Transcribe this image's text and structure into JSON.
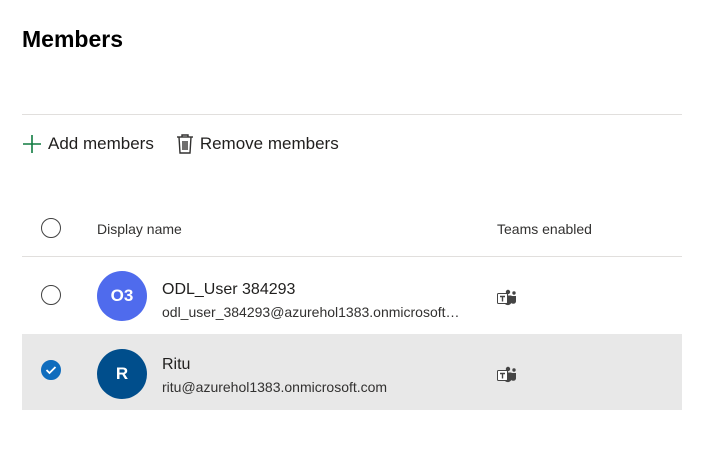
{
  "page": {
    "title": "Members"
  },
  "toolbar": {
    "add_label": "Add members",
    "add_icon": "plus-icon",
    "remove_label": "Remove members",
    "remove_icon": "trash-icon"
  },
  "table": {
    "columns": {
      "display_name": "Display name",
      "teams_enabled": "Teams enabled"
    },
    "rows": [
      {
        "initials": "O3",
        "avatar_color": "#4f6bed",
        "name": "ODL_User 384293",
        "email": "odl_user_384293@azurehol1383.onmicrosoft.com",
        "teams_icon": "teams-icon",
        "selected": false
      },
      {
        "initials": "R",
        "avatar_color": "#004e8c",
        "name": "Ritu",
        "email": "ritu@azurehol1383.onmicrosoft.com",
        "teams_icon": "teams-icon",
        "selected": true
      }
    ]
  },
  "colors": {
    "accent": "#0f6cbd",
    "selected_row": "#e8e8e8",
    "divider": "#e1dfdd"
  }
}
